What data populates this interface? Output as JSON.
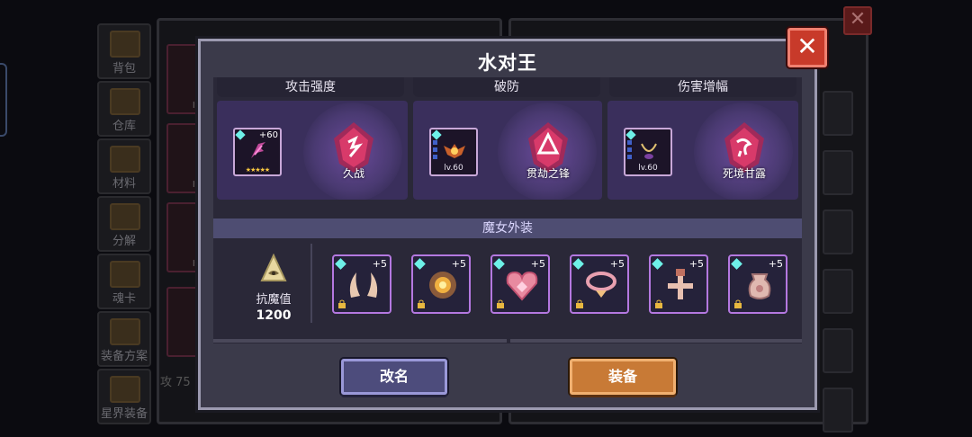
{
  "background": {
    "nav": [
      "背包",
      "仓库",
      "材料",
      "分解",
      "魂卡",
      "装备方案",
      "星界装备"
    ],
    "card_level": "lv.",
    "bottom_stat": "攻 75"
  },
  "modal": {
    "title": "水对王",
    "close_icon": "close-x-icon",
    "stats": [
      {
        "header": "攻击强度",
        "item_plus": "+60",
        "item_stars": "★★★★★",
        "rune": "久战"
      },
      {
        "header": "破防",
        "item_level": "lv.60",
        "rune": "贯劫之锋"
      },
      {
        "header": "伤害增幅",
        "item_level": "lv.60",
        "rune": "死境甘露"
      }
    ],
    "costume_section": {
      "title": "魔女外装",
      "resist_label": "抗魔值",
      "resist_value": "1200",
      "items": [
        {
          "name": "horns",
          "plus": "+5"
        },
        {
          "name": "gear-badge",
          "plus": "+5"
        },
        {
          "name": "heart",
          "plus": "+5"
        },
        {
          "name": "collar",
          "plus": "+5"
        },
        {
          "name": "cross",
          "plus": "+5"
        },
        {
          "name": "pouch",
          "plus": "+5"
        }
      ]
    },
    "buttons": {
      "rename": "改名",
      "equip": "装备"
    }
  },
  "colors": {
    "modal_bg": "#3b3a4a",
    "stat_block": "#3a2f5c",
    "rune": "#d83a6a",
    "rename_btn": "#4d4c7c",
    "equip_btn": "#c87a36",
    "close_btn": "#c83a2a"
  }
}
